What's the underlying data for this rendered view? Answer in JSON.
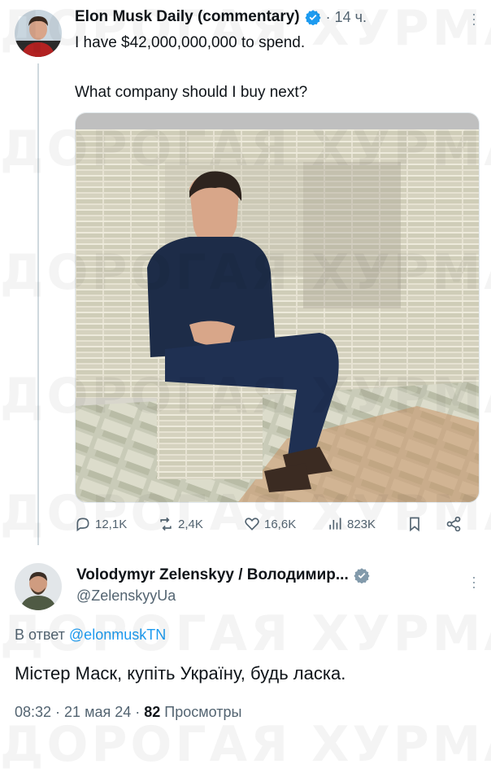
{
  "watermark_text": "ДОРОГАЯ ХУРМА",
  "tweet": {
    "author_name": "Elon Musk Daily (commentary)",
    "time": "· 14 ч.",
    "text_line1": "I have $42,000,000,000 to spend.",
    "text_line2": "What company should I buy next?",
    "actions": {
      "replies": "12,1K",
      "retweets": "2,4K",
      "likes": "16,6K",
      "views": "823K"
    }
  },
  "reply": {
    "author_name": "Volodymyr Zelenskyy / Володимир...",
    "handle": "@ZelenskyyUa",
    "reply_prefix": "В ответ",
    "reply_mention": "@elonmuskTN",
    "text": "Містер Маск, купіть Україну, будь ласка.",
    "footer_time": "08:32 · 21 мая 24 ·",
    "footer_views_count": "82",
    "footer_views_label": "Просмотры"
  },
  "colors": {
    "accent": "#1d9bf0",
    "secondary_text": "#536471",
    "primary_text": "#0f1419"
  }
}
